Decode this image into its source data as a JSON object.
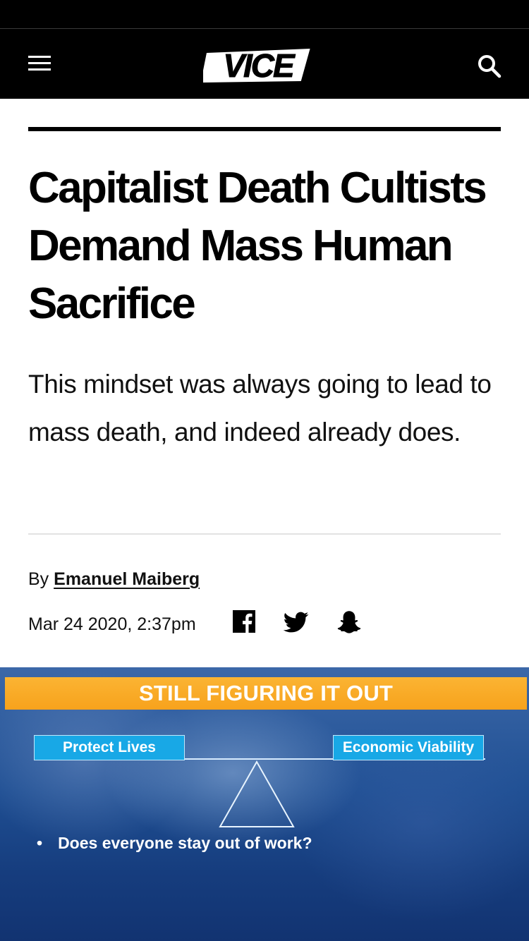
{
  "nav": {
    "logo_text": "VICE",
    "menu_icon": "hamburger-menu-icon",
    "search_icon": "search-icon"
  },
  "article": {
    "headline": "Capitalist Death Cultists Demand Mass Human Sacrifice",
    "dek": "This mindset was always going to lead to mass death, and indeed already does.",
    "byline_prefix": "By",
    "author": "Emanuel Maiberg",
    "date": "Mar 24 2020, 2:37pm"
  },
  "share": {
    "icons": [
      "facebook-icon",
      "twitter-icon",
      "snapchat-icon"
    ]
  },
  "hero": {
    "banner": "STILL FIGURING IT OUT",
    "left_box": "Protect Lives",
    "right_box": "Economic Viability",
    "bullet_marker": "•",
    "bullet": "Does everyone stay out of work?"
  },
  "colors": {
    "nav_bg": "#000000",
    "banner_orange": "#f7a21c",
    "box_blue": "#18a8e6",
    "hero_blue": "#1f4f93"
  }
}
